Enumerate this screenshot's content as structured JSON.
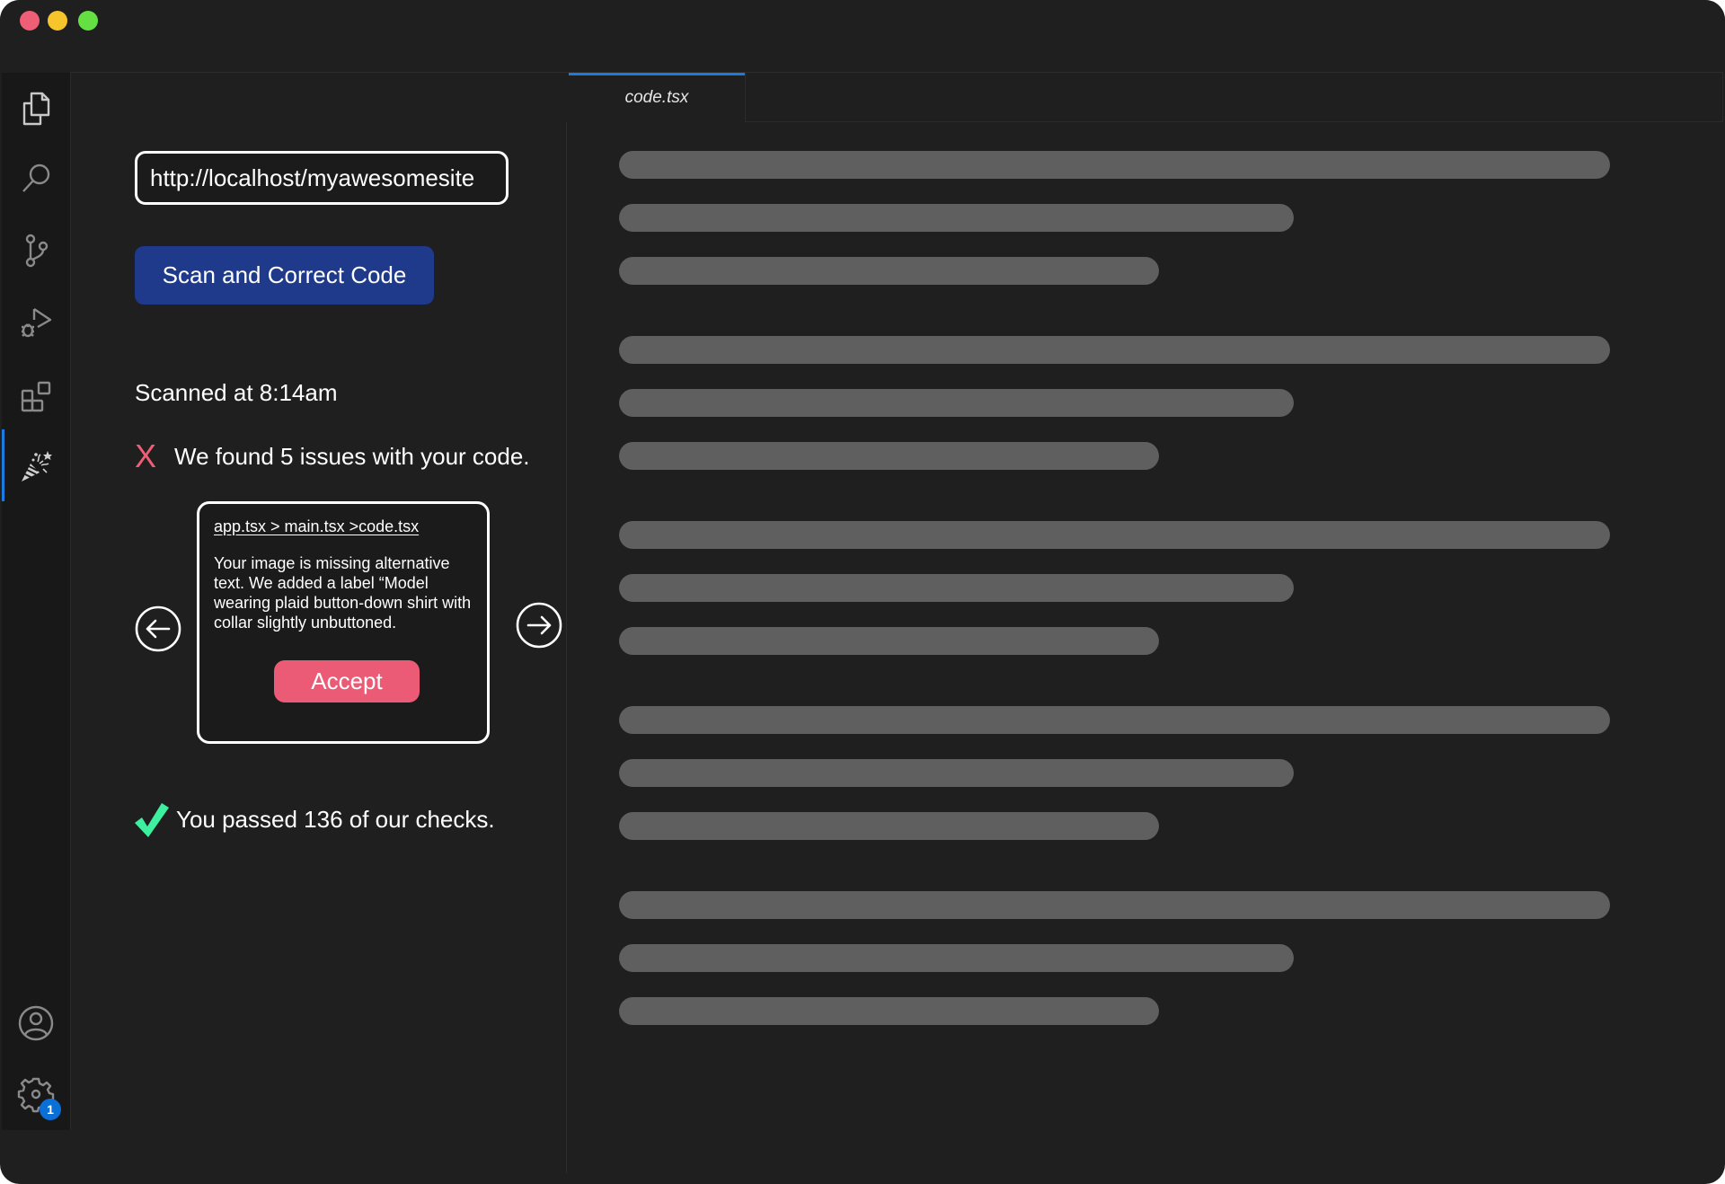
{
  "window": {
    "controls": [
      "close",
      "minimize",
      "maximize"
    ],
    "colors": {
      "close": "#ee5e76",
      "minimize": "#f6c52c",
      "maximize": "#64e042"
    }
  },
  "activity_bar": {
    "items": [
      {
        "id": "explorer",
        "icon": "files-icon"
      },
      {
        "id": "search",
        "icon": "search-icon"
      },
      {
        "id": "source-control",
        "icon": "source-control-icon"
      },
      {
        "id": "run-debug",
        "icon": "run-debug-icon"
      },
      {
        "id": "extensions",
        "icon": "extensions-icon"
      },
      {
        "id": "accessibility-scanner",
        "icon": "party-popper-icon",
        "active": true
      }
    ],
    "bottom_items": [
      {
        "id": "accounts",
        "icon": "account-icon"
      },
      {
        "id": "manage",
        "icon": "gear-icon",
        "badge": "1"
      }
    ],
    "accent": "#1a7be0"
  },
  "scanner": {
    "url_value": "http://localhost/myawesomesite",
    "scan_button": "Scan and Correct Code",
    "scanned_at": "Scanned at 8:14am",
    "issues_text": "We found 5 issues with your code.",
    "issues_icon": "X",
    "issue_card": {
      "breadcrumb": "app.tsx > main.tsx >code.tsx",
      "description": "Your image is missing alternative text. We added a label  “Model wearing plaid button-down shirt with collar slightly unbuttoned.",
      "accept_label": "Accept"
    },
    "passed_text": "You passed 136 of our checks.",
    "colors": {
      "scan_button": "#1f3a8a",
      "error": "#ee5e76",
      "accept": "#ec5b76",
      "success": "#3cf0a0"
    }
  },
  "editor": {
    "tabs": [
      {
        "label": "code.tsx",
        "active": true
      }
    ],
    "placeholder_groups": 5,
    "placeholder_line_widths": [
      "long",
      "medium",
      "short"
    ]
  }
}
